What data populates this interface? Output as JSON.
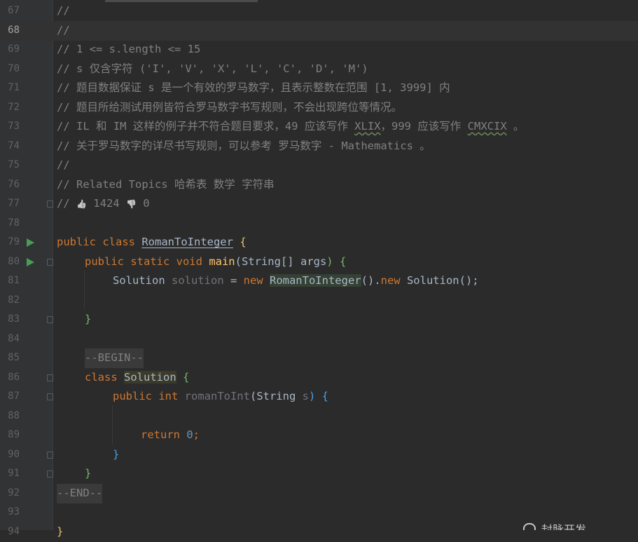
{
  "editor": {
    "current_line": "68",
    "lines": [
      {
        "n": "67",
        "text": "//"
      },
      {
        "n": "68",
        "text": "//"
      },
      {
        "n": "69",
        "text": "// 1 <= s.length <= 15"
      },
      {
        "n": "70",
        "text": "// s 仅含字符 ('I', 'V', 'X', 'L', 'C', 'D', 'M')"
      },
      {
        "n": "71",
        "text": "// 题目数据保证 s 是一个有效的罗马数字，且表示整数在范围 [1, 3999] 内"
      },
      {
        "n": "72",
        "text": "// 题目所给测试用例皆符合罗马数字书写规则，不会出现跨位等情况。"
      },
      {
        "n": "73",
        "text_a": "// IL 和 IM 这样的例子并不符合题目要求，49 应该写作 ",
        "text_b": "XLIX",
        "text_c": "，999 应该写作 ",
        "text_d": "CMXCIX",
        "text_e": " 。"
      },
      {
        "n": "74",
        "text": "// 关于罗马数字的详尽书写规则，可以参考 罗马数字 - Mathematics 。"
      },
      {
        "n": "75",
        "text": "//"
      },
      {
        "n": "76",
        "text": "// Related Topics 哈希表 数学 字符串"
      },
      {
        "n": "77",
        "text_a": "// ",
        "thumb_up": "👍",
        "likes": " 1424 ",
        "thumb_down": "👎",
        "dislikes": " 0"
      },
      {
        "n": "78",
        "text": ""
      },
      {
        "n": "79",
        "kw1": "public class ",
        "cls": "RomanToInteger",
        "brace": " {"
      },
      {
        "n": "80",
        "kw1": "public static void ",
        "fn": "main",
        "params_a": "(String[] ",
        "param": "args",
        "params_b": ") {"
      },
      {
        "n": "81",
        "t1": "Solution ",
        "var": "solution",
        "t2": " = ",
        "kw": "new ",
        "cls": "RomanToInteger",
        "t3": "().",
        "kw2": "new",
        "t4": " Solution();"
      },
      {
        "n": "82",
        "text": ""
      },
      {
        "n": "83",
        "text": "}"
      },
      {
        "n": "84",
        "text": ""
      },
      {
        "n": "85",
        "text": "--BEGIN--"
      },
      {
        "n": "86",
        "kw": "class ",
        "cls": "Solution",
        "brace": " {"
      },
      {
        "n": "87",
        "kw": "public int ",
        "fn": "romanToInt",
        "p_a": "(String ",
        "p": "s",
        "p_b": ") {"
      },
      {
        "n": "88",
        "text": ""
      },
      {
        "n": "89",
        "kw": "return ",
        "num": "0",
        "semi": ";"
      },
      {
        "n": "90",
        "text": "}"
      },
      {
        "n": "91",
        "text": "}"
      },
      {
        "n": "92",
        "text": "--END--"
      },
      {
        "n": "93",
        "text": ""
      },
      {
        "n": "94",
        "text": "}"
      }
    ]
  },
  "watermark": "封脉开发"
}
